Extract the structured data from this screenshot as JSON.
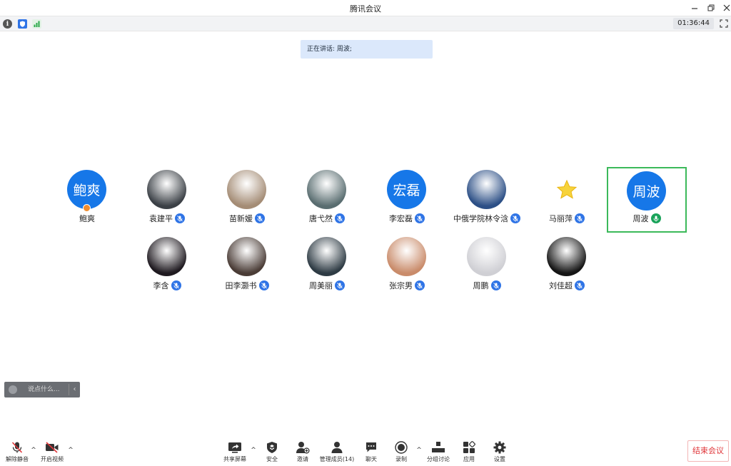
{
  "window": {
    "title": "腾讯会议"
  },
  "infobar": {
    "timer": "01:36:44"
  },
  "banner": {
    "speaking": "正在讲话: 周波;"
  },
  "participants": [
    {
      "name": "鲍爽",
      "avatar_text": "鲍爽",
      "avatar_type": "text",
      "host": true,
      "mic": ""
    },
    {
      "name": "袁建平",
      "avatar_type": "photo",
      "photo_color": "#3b4046",
      "mic": "muted"
    },
    {
      "name": "苗新媛",
      "avatar_type": "photo",
      "photo_color": "#a48c75",
      "mic": "muted"
    },
    {
      "name": "唐弋然",
      "avatar_type": "photo",
      "photo_color": "#596d70",
      "mic": "muted"
    },
    {
      "name": "李宏磊",
      "avatar_text": "宏磊",
      "avatar_type": "text",
      "mic": "muted"
    },
    {
      "name": "中俄学院林令浛",
      "avatar_type": "photo",
      "photo_color": "#2c4f86",
      "mic": "muted"
    },
    {
      "name": "马丽萍",
      "avatar_type": "star",
      "mic": "muted"
    },
    {
      "name": "周波",
      "avatar_text": "周波",
      "avatar_type": "text",
      "mic": "speaking",
      "selected": true
    },
    {
      "name": "李含",
      "avatar_type": "photo",
      "photo_color": "#1f1a20",
      "mic": "muted"
    },
    {
      "name": "田李灏书",
      "avatar_type": "photo",
      "photo_color": "#4a3c36",
      "mic": "muted"
    },
    {
      "name": "周美丽",
      "avatar_type": "photo",
      "photo_color": "#2e3b44",
      "mic": "muted"
    },
    {
      "name": "张宗男",
      "avatar_type": "photo",
      "photo_color": "#c98b6a",
      "mic": "muted"
    },
    {
      "name": "周鹏",
      "avatar_type": "photo",
      "photo_color": "#cfcfd4",
      "mic": "muted"
    },
    {
      "name": "刘佳超",
      "avatar_type": "photo",
      "photo_color": "#151515",
      "mic": "muted"
    }
  ],
  "chat": {
    "placeholder": "说点什么..."
  },
  "toolbar": {
    "unmute": "解除静音",
    "start_video": "开启视频",
    "share_screen": "共享屏幕",
    "security": "安全",
    "invite": "邀请",
    "manage_members": "管理成员(14)",
    "chat": "聊天",
    "record": "录制",
    "breakout": "分组讨论",
    "apps": "应用",
    "settings": "设置",
    "end_meeting": "结束会议"
  },
  "colors": {
    "accent": "#1677e8",
    "speaking": "#1aa35a",
    "selected_border": "#3cb95a",
    "end": "#e0373b"
  }
}
